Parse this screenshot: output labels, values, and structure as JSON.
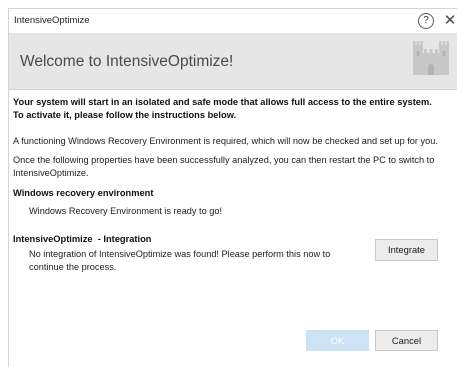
{
  "window": {
    "title": "IntensiveOptimize",
    "help_glyph": "?",
    "close_glyph": "✕"
  },
  "header": {
    "title": "Welcome to IntensiveOptimize!",
    "logo_icon": "castle-icon"
  },
  "content": {
    "intro": "Your system will start in an isolated and safe mode that allows full access to the entire system. To activate it, please follow the instructions below.",
    "para1": "A functioning Windows Recovery Environment is required, which will now be checked and set up for you.",
    "para2": "Once the following properties have been successfully analyzed, you can then restart the PC to switch to IntensiveOptimize."
  },
  "sections": {
    "recovery": {
      "heading": "Windows recovery environment",
      "status": "Windows Recovery Environment is ready to go!"
    },
    "integration": {
      "heading": "IntensiveOptimize  - Integration",
      "status": "No integration of IntensiveOptimize was found! Please perform this now to continue the process.",
      "button_label": "Integrate"
    }
  },
  "footer": {
    "ok_label": "OK",
    "cancel_label": "Cancel"
  },
  "colors": {
    "header_band": "#e6e6e6",
    "ok_disabled": "#cde3f5",
    "button_bg": "#ececec"
  }
}
